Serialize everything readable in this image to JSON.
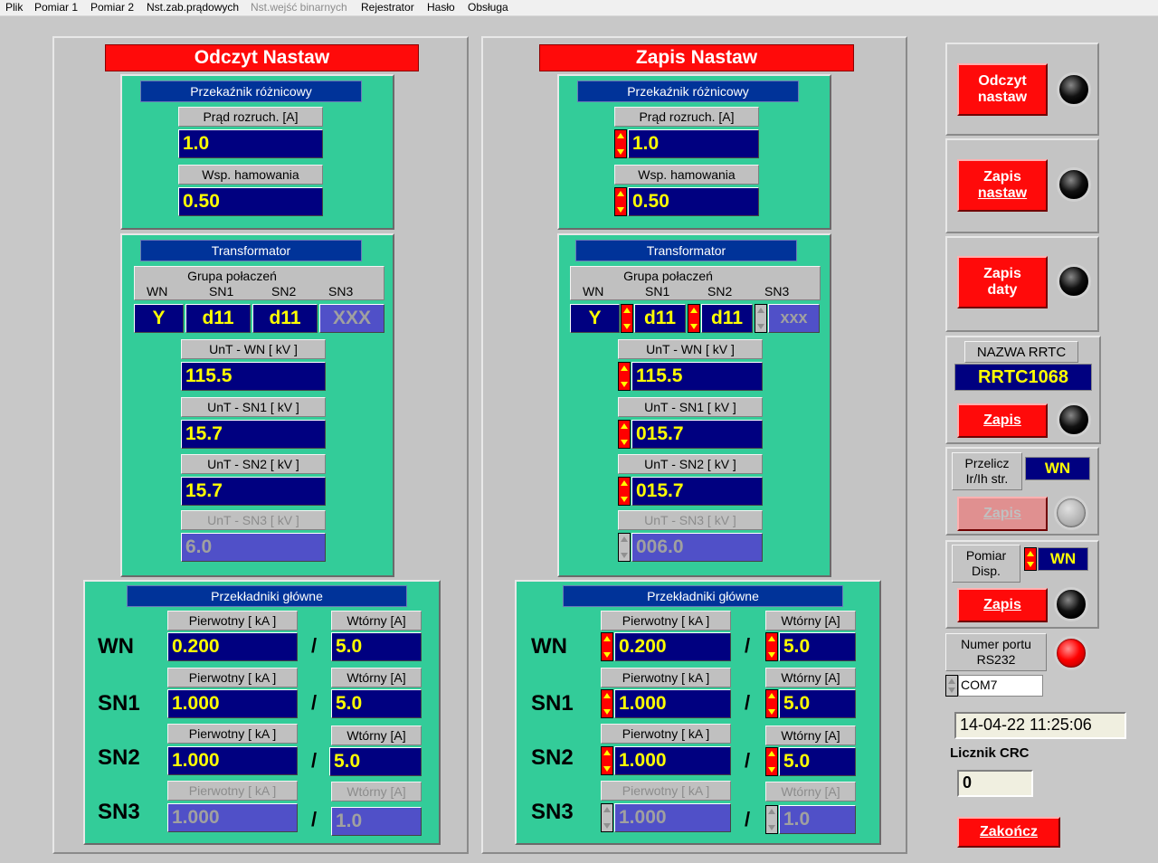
{
  "menu": [
    {
      "label": "Plik",
      "disabled": false
    },
    {
      "label": "Pomiar 1",
      "disabled": false
    },
    {
      "label": "Pomiar 2",
      "disabled": false
    },
    {
      "label": "Nst.zab.prądowych",
      "disabled": false
    },
    {
      "label": "Nst.wejść binarnych",
      "disabled": true
    },
    {
      "label": "Rejestrator",
      "disabled": false
    },
    {
      "label": "Hasło",
      "disabled": false
    },
    {
      "label": "Obsługa",
      "disabled": false
    }
  ],
  "read": {
    "title": "Odczyt Nastaw",
    "diff": {
      "header": "Przekaźnik różnicowy",
      "start_label": "Prąd rozruch. [A]",
      "start_value": "1.0",
      "brake_label": "Wsp. hamowania",
      "brake_value": "0.50"
    },
    "transformer": {
      "header": "Transformator",
      "group_label": "Grupa  połaczeń",
      "col_labels": [
        "WN",
        "SN1",
        "SN2",
        "SN3"
      ],
      "group_values": [
        "Y",
        "d11",
        "d11",
        "XXX"
      ],
      "unt_wn_label": "UnT - WN [ kV ]",
      "unt_wn_value": "115.5",
      "unt_sn1_label": "UnT - SN1 [ kV ]",
      "unt_sn1_value": "15.7",
      "unt_sn2_label": "UnT - SN2 [ kV ]",
      "unt_sn2_value": "15.7",
      "unt_sn3_label": "UnT - SN3 [ kV ]",
      "unt_sn3_value": "6.0"
    },
    "ct": {
      "header": "Przekładniki główne",
      "primary_label": "Pierwotny [ kA ]",
      "secondary_label": "Wtórny [A]",
      "slash": "/",
      "rows": [
        {
          "name": "WN",
          "primary": "0.200",
          "secondary": "5.0"
        },
        {
          "name": "SN1",
          "primary": "1.000",
          "secondary": "5.0"
        },
        {
          "name": "SN2",
          "primary": "1.000",
          "secondary": "5.0"
        },
        {
          "name": "SN3",
          "primary": "1.000",
          "secondary": "1.0"
        }
      ]
    }
  },
  "write": {
    "title": "Zapis Nastaw",
    "diff": {
      "header": "Przekaźnik różnicowy",
      "start_label": "Prąd rozruch. [A]",
      "start_value": "1.0",
      "brake_label": "Wsp. hamowania",
      "brake_value": "0.50"
    },
    "transformer": {
      "header": "Transformator",
      "group_label": "Grupa  połaczeń",
      "col_labels": [
        "WN",
        "SN1",
        "SN2",
        "SN3"
      ],
      "group_values": [
        "Y",
        "d11",
        "d11",
        "xxx"
      ],
      "unt_wn_label": "UnT - WN [ kV ]",
      "unt_wn_value": "115.5",
      "unt_sn1_label": "UnT - SN1 [ kV ]",
      "unt_sn1_value": "015.7",
      "unt_sn2_label": "UnT - SN2 [ kV ]",
      "unt_sn2_value": "015.7",
      "unt_sn3_label": "UnT - SN3 [ kV ]",
      "unt_sn3_value": "006.0"
    },
    "ct": {
      "header": "Przekładniki główne",
      "primary_label": "Pierwotny [ kA ]",
      "secondary_label": "Wtórny [A]",
      "slash": "/",
      "rows": [
        {
          "name": "WN",
          "primary": "0.200",
          "secondary": "5.0"
        },
        {
          "name": "SN1",
          "primary": "1.000",
          "secondary": "5.0"
        },
        {
          "name": "SN2",
          "primary": "1.000",
          "secondary": "5.0"
        },
        {
          "name": "SN3",
          "primary": "1.000",
          "secondary": "1.0"
        }
      ]
    }
  },
  "side": {
    "read_btn_line1": "Odczyt",
    "read_btn_line2": "nastaw",
    "write_btn_line1": "Zapis",
    "write_btn_line2": "nastaw",
    "date_btn_line1": "Zapis",
    "date_btn_line2": "daty",
    "rrtc_label": "NAZWA RRTC",
    "rrtc_value": "RRTC1068",
    "rrtc_save": "Zapis",
    "recalc_label_line1": "Przelicz",
    "recalc_label_line2": "Ir/Ih str.",
    "recalc_value": "WN",
    "recalc_save": "Zapis",
    "disp_label_line1": "Pomiar",
    "disp_label_line2": "Disp.",
    "disp_value": "WN",
    "disp_save": "Zapis",
    "port_label_line1": "Numer portu",
    "port_label_line2": "RS232",
    "port_value": "COM7",
    "datetime": "14-04-22 11:25:06",
    "crc_label": "Licznik CRC",
    "crc_value": "0",
    "exit": "Zakończ"
  }
}
